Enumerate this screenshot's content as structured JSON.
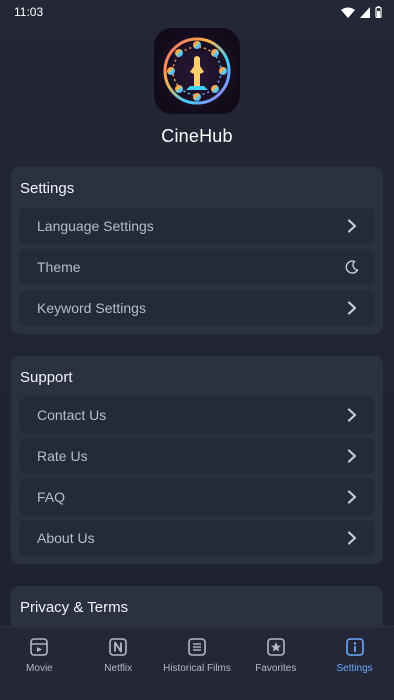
{
  "status_bar": {
    "time": "11:03"
  },
  "app": {
    "name": "CineHub"
  },
  "sections": {
    "settings": {
      "title": "Settings",
      "items": [
        {
          "label": "Language Settings",
          "icon": "chevron-right-icon"
        },
        {
          "label": "Theme",
          "icon": "moon-icon"
        },
        {
          "label": "Keyword Settings",
          "icon": "chevron-right-icon"
        }
      ]
    },
    "support": {
      "title": "Support",
      "items": [
        {
          "label": "Contact Us",
          "icon": "chevron-right-icon"
        },
        {
          "label": "Rate Us",
          "icon": "chevron-right-icon"
        },
        {
          "label": "FAQ",
          "icon": "chevron-right-icon"
        },
        {
          "label": "About Us",
          "icon": "chevron-right-icon"
        }
      ]
    },
    "privacy": {
      "title": "Privacy & Terms"
    }
  },
  "bottom_nav": {
    "items": [
      {
        "label": "Movie",
        "icon": "movie-icon"
      },
      {
        "label": "Netflix",
        "icon": "netflix-icon"
      },
      {
        "label": "Historical Films",
        "icon": "list-icon"
      },
      {
        "label": "Favorites",
        "icon": "star-icon"
      },
      {
        "label": "Settings",
        "icon": "info-icon",
        "active": true
      }
    ]
  },
  "colors": {
    "accent": "#6ea8ff",
    "background": "#232736",
    "card": "#2c3142",
    "row": "#252a3a"
  }
}
